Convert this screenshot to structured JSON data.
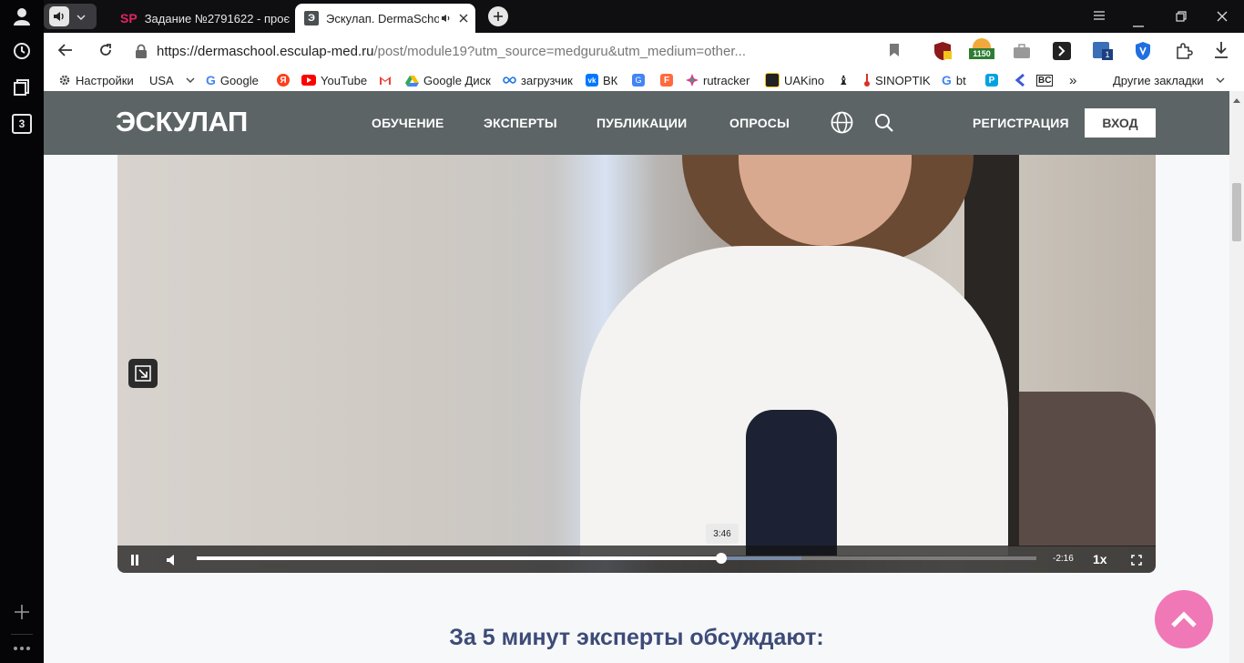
{
  "browser": {
    "tabs": [
      {
        "favicon": "SP",
        "title": "Задание №2791622 - проє"
      },
      {
        "favicon": "Э",
        "title": "Эскулап. DermaSchool"
      }
    ],
    "sidebar_counter": "3",
    "url": {
      "host": "https://dermaschool.esculap-med.ru",
      "path": "/post/module19?utm_source=medguru&utm_medium=other..."
    },
    "extensions": {
      "badge_count": "1150",
      "badge_small": "1"
    },
    "bookmarks": [
      {
        "label": "Настройки",
        "icon": "gear-icon",
        "color": "#444444"
      },
      {
        "label": "USA",
        "icon": "chevron-down-icon",
        "color": "#ffffff"
      },
      {
        "label": "Google",
        "icon": "google-icon",
        "color": "#4285f4"
      },
      {
        "label": "",
        "icon": "yandex-icon",
        "color": "#fc3f1d"
      },
      {
        "label": "YouTube",
        "icon": "youtube-icon",
        "color": "#ff0000"
      },
      {
        "label": "",
        "icon": "gmail-icon",
        "color": "#ea4335"
      },
      {
        "label": "Google Диск",
        "icon": "drive-icon",
        "color": "#34a853"
      },
      {
        "label": "загрузчик",
        "icon": "loader-icon",
        "color": "#1a73e8"
      },
      {
        "label": "ВК",
        "icon": "vk-icon",
        "color": "#0077ff"
      },
      {
        "label": "",
        "icon": "translate-icon",
        "color": "#4285f4"
      },
      {
        "label": "",
        "icon": "feedly-icon",
        "color": "#ff6a3d"
      },
      {
        "label": "rutracker",
        "icon": "rutracker-icon",
        "color": "#d83b9a"
      },
      {
        "label": "UAKino",
        "icon": "uakino-icon",
        "color": "#222222"
      },
      {
        "label": "",
        "icon": "chess-icon",
        "color": "#222222"
      },
      {
        "label": "SINOPTIK",
        "icon": "thermometer-icon",
        "color": "#d93025"
      },
      {
        "label": "bt",
        "icon": "google-icon",
        "color": "#4285f4"
      },
      {
        "label": "",
        "icon": "p-icon",
        "color": "#00a3e0"
      },
      {
        "label": "",
        "icon": "arrow-icon",
        "color": "#3b5bdb"
      },
      {
        "label": "",
        "icon": "bc-icon",
        "color": "#222222"
      }
    ],
    "more_bookmarks": "»",
    "other_bookmarks": "Другие закладки"
  },
  "site": {
    "logo": "ЭСКУЛАП",
    "nav": [
      "ОБУЧЕНИЕ",
      "ЭКСПЕРТЫ",
      "ПУБЛИКАЦИИ",
      "ОПРОСЫ"
    ],
    "register": "РЕГИСТРАЦИЯ",
    "login": "ВХОД",
    "header_color": "#5d6466"
  },
  "video": {
    "tooltip_time": "3:46",
    "remaining": "-2:16",
    "speed": "1x",
    "progress": 0.625,
    "buffered": 0.72
  },
  "content": {
    "heading": "За 5 минут эксперты обсуждают:"
  },
  "colors": {
    "accent": "#f178b6",
    "heading": "#3c4b78"
  }
}
